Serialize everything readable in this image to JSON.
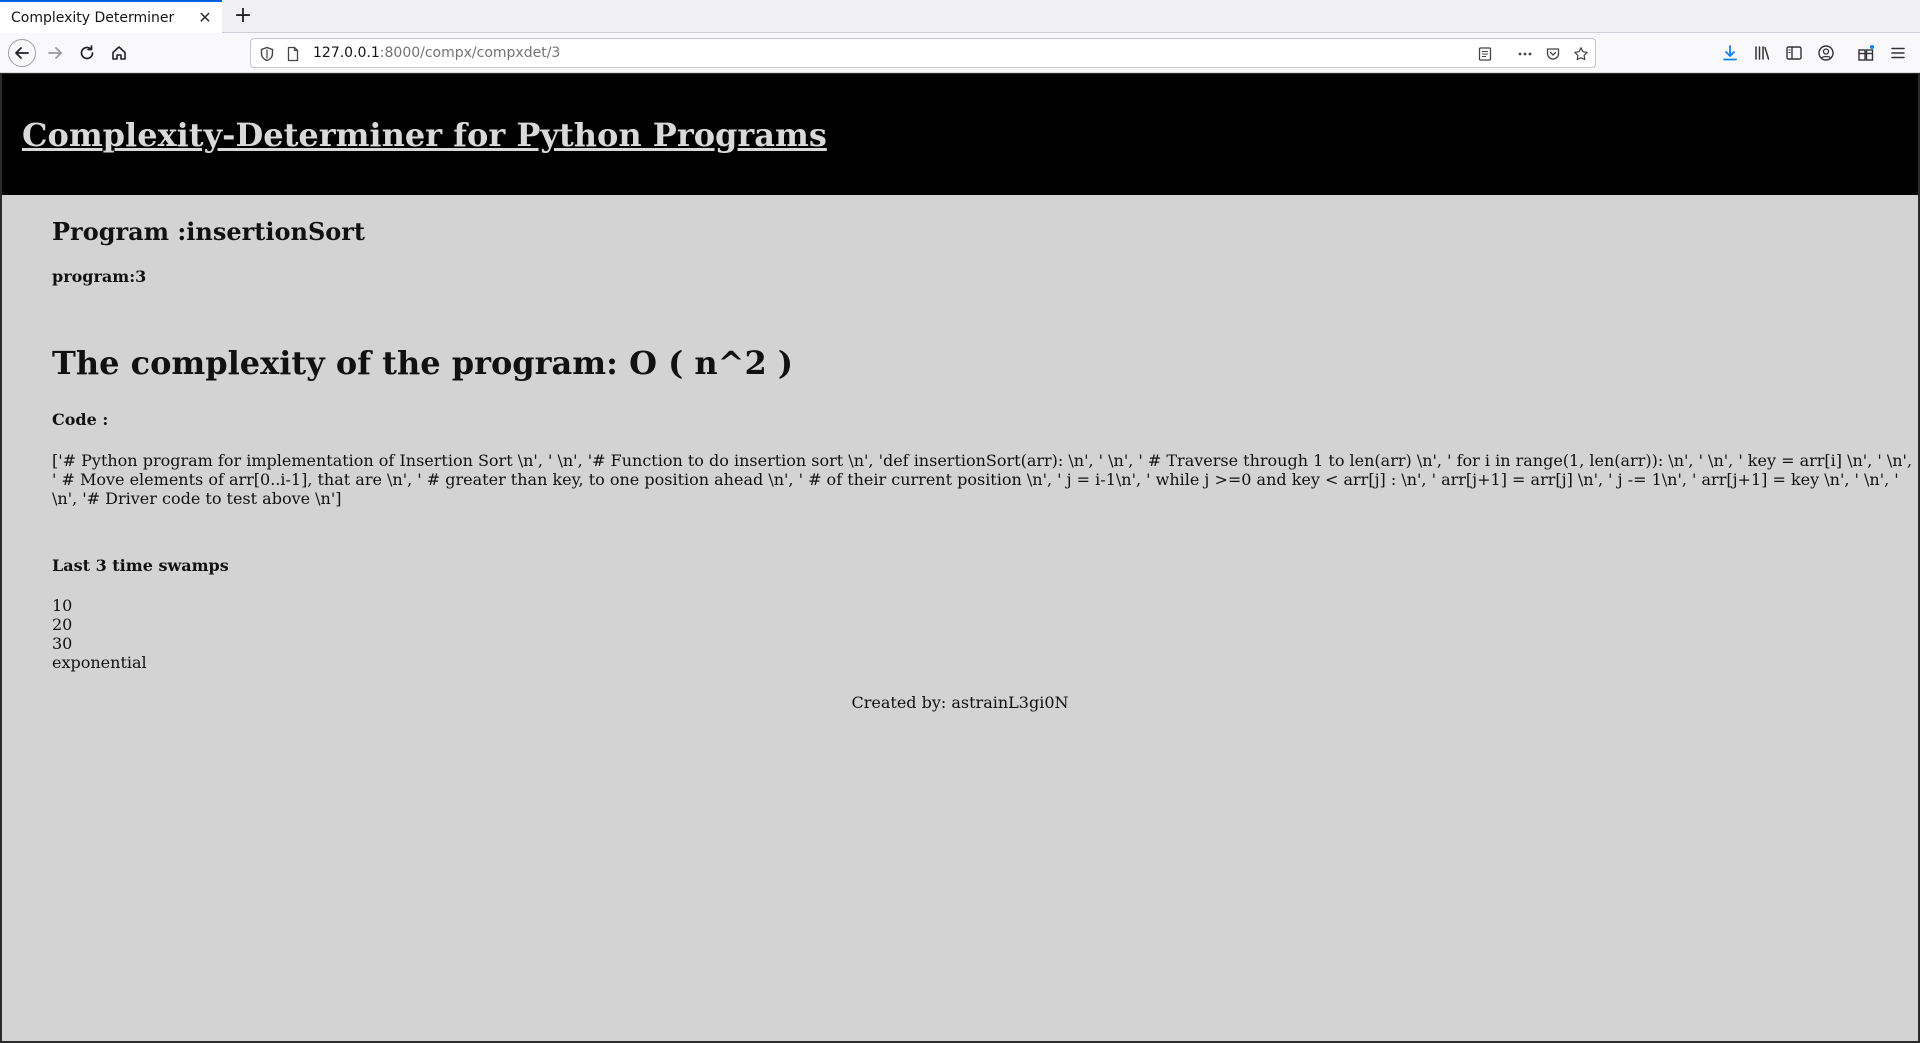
{
  "browser": {
    "tab_title": "Complexity Determiner",
    "tab_close": "✕",
    "new_tab": "+",
    "url_host": "127.0.0.1",
    "url_rest": ":8000/compx/compxdet/3"
  },
  "colors": {
    "header_bg": "#000000",
    "page_bg": "#d3d3d3",
    "header_link": "#d9d9d9"
  },
  "header": {
    "title": "Complexity-Determiner for Python Programs"
  },
  "program": {
    "title": "Program :insertionSort",
    "id_label": "program:3",
    "complexity": "The complexity of the program: O ( n^2 )",
    "code_label": "Code :",
    "code": "['# Python program for implementation of Insertion Sort \\n', ' \\n', '# Function to do insertion sort \\n', 'def insertionSort(arr): \\n', ' \\n', ' # Traverse through 1 to len(arr) \\n', ' for i in range(1, len(arr)): \\n', ' \\n', ' key = arr[i] \\n', ' \\n', ' # Move elements of arr[0..i-1], that are \\n', ' # greater than key, to one position ahead \\n', ' # of their current position \\n', ' j = i-1\\n', ' while j >=0 and key < arr[j] : \\n', ' arr[j+1] = arr[j] \\n', ' j -= 1\\n', ' arr[j+1] = key \\n', ' \\n', ' \\n', '# Driver code to test above \\n']"
  },
  "swamps": {
    "label": "Last 3 time swamps",
    "items": [
      "10",
      "20",
      "30",
      "exponential"
    ]
  },
  "footer": {
    "credit": "Created by: astrainL3gi0N"
  }
}
